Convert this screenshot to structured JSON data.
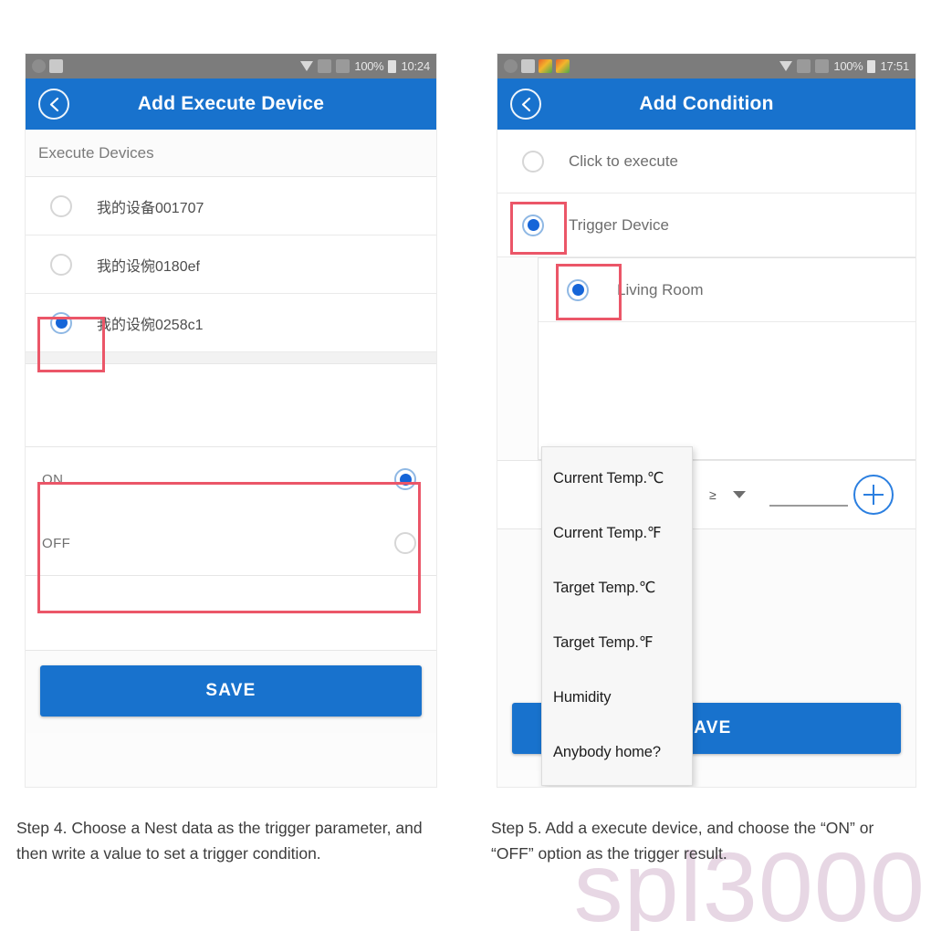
{
  "left_phone": {
    "statusbar": {
      "battery_pct": "100%",
      "time": "10:24",
      "left_icons": [
        "notification-icon",
        "screenshot-icon"
      ],
      "right_icons": [
        "wifi-icon",
        "sd-card-icon",
        "signal-icon",
        "battery-icon"
      ]
    },
    "appbar": {
      "title": "Add Execute Device",
      "back_icon": "back-chevron-icon"
    },
    "section_title": "Execute Devices",
    "devices": [
      {
        "label": "我的设备001707",
        "selected": false
      },
      {
        "label": "我的设倇0180ef",
        "selected": false
      },
      {
        "label": "我的设倇0258c1",
        "selected": true
      }
    ],
    "state_options": [
      {
        "label": "ON",
        "selected": true
      },
      {
        "label": "OFF",
        "selected": false
      }
    ],
    "save_label": "SAVE"
  },
  "right_phone": {
    "statusbar": {
      "battery_pct": "100%",
      "time": "17:51",
      "left_icons": [
        "notification-icon",
        "screenshot-icon",
        "app-icon",
        "app-icon"
      ],
      "right_icons": [
        "wifi-icon",
        "sd-card-icon",
        "signal-icon",
        "battery-icon"
      ]
    },
    "appbar": {
      "title": "Add Condition",
      "back_icon": "back-chevron-icon"
    },
    "conditions": [
      {
        "label": "Click to execute",
        "selected": false
      },
      {
        "label": "Trigger Device",
        "selected": true
      }
    ],
    "rooms": [
      {
        "label": "Living Room",
        "selected": true
      }
    ],
    "condition_row": {
      "operator": "≥",
      "value": "",
      "add_icon": "plus-circle-icon"
    },
    "dropdown": {
      "items": [
        "Current Temp.℃",
        "Current Temp.℉",
        "Target Temp.℃",
        "Target Temp.℉",
        "Humidity",
        "Anybody home?"
      ]
    },
    "save_label": "SAVE"
  },
  "captions": {
    "step4": "Step 4. Choose a Nest data as the trigger parameter, and then write a value to set a trigger condition.",
    "step5": "Step 5. Add a execute device, and choose the “ON” or “OFF” option as the trigger result."
  },
  "watermark": "spl3000",
  "colors": {
    "appbar_blue": "#1872cd",
    "radio_blue": "#1565d8",
    "annotation_red": "#eb5668",
    "statusbar_grey": "#7c7c7c",
    "watermark_pink": "#e7d7e4"
  }
}
